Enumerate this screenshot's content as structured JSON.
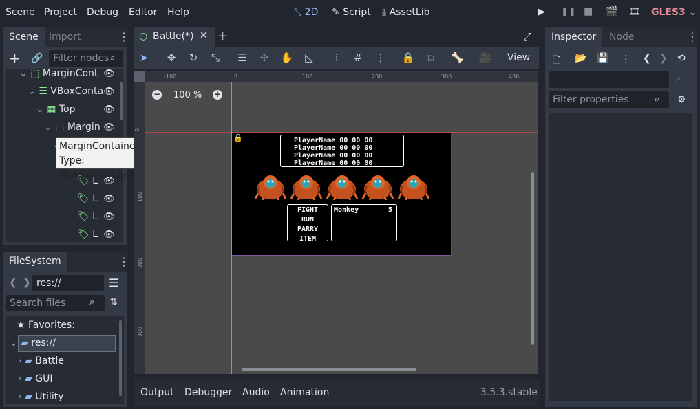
{
  "menubar": {
    "items": [
      "Scene",
      "Project",
      "Debug",
      "Editor",
      "Help"
    ],
    "workspaces": [
      "2D",
      "Script",
      "AssetLib"
    ],
    "renderer": "GLES3"
  },
  "scene_dock": {
    "tabs": [
      "Scene",
      "Import"
    ],
    "filter_placeholder": "Filter nodes",
    "nodes": [
      {
        "label": "MarginCont",
        "type": "margin"
      },
      {
        "label": "VBoxConta",
        "type": "vbox"
      },
      {
        "label": "Top",
        "type": "grid"
      },
      {
        "label": "Margin",
        "type": "margin"
      },
      {
        "label": "L",
        "type": "label"
      },
      {
        "label": "L",
        "type": "label"
      },
      {
        "label": "L",
        "type": "label"
      },
      {
        "label": "L",
        "type": "label"
      }
    ],
    "tooltip": {
      "line1": "MarginContainer",
      "line2": "Type: MarginContainer"
    }
  },
  "filesystem_dock": {
    "title": "FileSystem",
    "path": "res://",
    "search_placeholder": "Search files",
    "favorites": "Favorites:",
    "root": "res://",
    "folders": [
      "Battle",
      "GUI",
      "Utility"
    ]
  },
  "editor": {
    "scene_tab": "Battle(*)",
    "view_label": "View",
    "zoom": "100 %",
    "ruler_top": [
      "-100",
      "0",
      "100",
      "200",
      "300",
      "400"
    ],
    "ruler_left": [
      "0",
      "100",
      "200",
      "300"
    ]
  },
  "game": {
    "players": [
      "PlayerName 00 00 00",
      "PlayerName 00 00 00",
      "PlayerName 00 00 00",
      "PlayerName 00 00 00"
    ],
    "menu": [
      "FIGHT",
      "RUN",
      "PARRY",
      "ITEM"
    ],
    "enemy_name": "Monkey",
    "enemy_count": "5",
    "monkey_count": 5
  },
  "bottom_panel": {
    "tabs": [
      "Output",
      "Debugger",
      "Audio",
      "Animation"
    ],
    "version": "3.5.3.stable"
  },
  "inspector": {
    "tabs": [
      "Inspector",
      "Node"
    ],
    "filter_placeholder": "Filter properties"
  }
}
